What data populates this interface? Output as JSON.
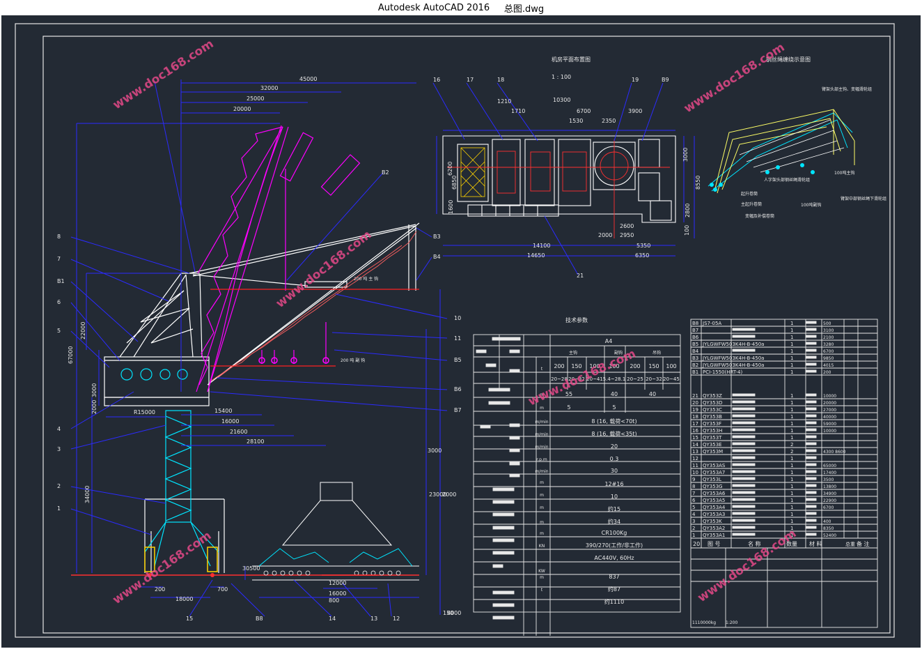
{
  "window": {
    "app": "Autodesk AutoCAD 2016",
    "file": "总图.dwg"
  },
  "colors": {
    "background": "#232a34",
    "frame": "#e6e6e6",
    "dimension": "#0000ff",
    "crane_boom": "#ff00ff",
    "crane_tower": "#00e5ff",
    "structure": "#ffffff",
    "load_marks": "#ff0000",
    "rigging": "#ffff66",
    "annotation": "#e8e8e8"
  },
  "watermark": "www.doc168.com",
  "plan_view": {
    "title": "机房平面布置图",
    "scale": "1 : 100",
    "labels": [
      "16",
      "17",
      "18",
      "19",
      "B9"
    ],
    "dims_top": [
      "10300",
      "1710",
      "6700",
      "1530",
      "2350",
      "3900",
      "1210"
    ],
    "dims_bottom": [
      "14100",
      "14650",
      "2000",
      "2950",
      "2600",
      "5350",
      "6350"
    ],
    "dims_side": [
      "6200",
      "6850",
      "1600",
      "3000",
      "8550",
      "2800",
      "100"
    ],
    "leader": "21"
  },
  "rigging_view": {
    "title": "钢丝绳缠绕示意图",
    "notes": [
      "臂架头部主钩、变幅滑轮组",
      "100吨主钩",
      "人字架头部钢丝绳滑轮组",
      "起升卷筒",
      "主起升卷筒",
      "100吨副钩",
      "臂架中部钢丝绳下滑轮组",
      "变幅及补偿卷筒"
    ]
  },
  "elevation": {
    "top_dims": [
      "45000",
      "32000",
      "25000",
      "20000"
    ],
    "side_dims": [
      "67000",
      "22000",
      "3000",
      "2000",
      "34000"
    ],
    "bottom_dims": [
      "R15000",
      "15400",
      "16000",
      "21600",
      "28100",
      "200",
      "18000",
      "700",
      "12000",
      "16000",
      "800",
      "30500",
      "150",
      "2000",
      "3000",
      "4000",
      "23000"
    ],
    "callouts_left": [
      "8",
      "7",
      "B1",
      "6",
      "5",
      "4",
      "3",
      "2",
      "1"
    ],
    "callouts_right": [
      "B2",
      "B3",
      "B4",
      "10",
      "11",
      "B5",
      "B6",
      "B7"
    ],
    "callouts_bottom": [
      "15",
      "B8",
      "14",
      "13",
      "12"
    ],
    "side_notes": [
      "200 吨 主 钩",
      "200 吨 副 钩"
    ]
  },
  "tech_table": {
    "title": "技术参数",
    "header": "A4",
    "subheads": [
      "主钩",
      "副钩",
      "吊钩"
    ],
    "loads": [
      "200",
      "150",
      "100",
      "100",
      "200",
      "150",
      "100"
    ],
    "ranges": [
      "20~28",
      "20~32",
      "20~41",
      "5.4~28.1",
      "20~25",
      "20~32",
      "20~45"
    ],
    "row_units": [
      "t",
      "m",
      "m",
      "m/min",
      "m/min",
      "m/min",
      "r.p.m",
      "m/min",
      "m",
      "m",
      "m",
      "m",
      "m",
      "KN",
      "",
      "KW",
      "m",
      "t"
    ],
    "rows": [
      "55",
      "40",
      "40",
      "5",
      "5",
      "8 (16, 载荷<70t)",
      "8 (16, 载荷<35t)",
      "20",
      "0.3",
      "30",
      "12#16",
      "10",
      "约15",
      "约34",
      "CR100Kg",
      "390/270(工作/非工作)",
      "AC440V, 60Hz",
      "837",
      "约87",
      "约1110"
    ]
  },
  "parts_list": {
    "rows": [
      {
        "no": "B8",
        "code": "JS7-05A",
        "qty": "1",
        "mass": "500"
      },
      {
        "no": "B7",
        "code": "",
        "qty": "1",
        "mass": "3100"
      },
      {
        "no": "B6",
        "code": "",
        "qty": "1",
        "mass": "2100"
      },
      {
        "no": "B5",
        "code": "JYLGWFW503K4H-B-450a",
        "qty": "1",
        "mass": "3280"
      },
      {
        "no": "B4",
        "code": "",
        "qty": "1",
        "mass": "6700"
      },
      {
        "no": "B3",
        "code": "JYLGWFW503K4H-B-450a",
        "qty": "1",
        "mass": "9850"
      },
      {
        "no": "B2",
        "code": "JYLGWFW503K4H-B-450a",
        "qty": "1",
        "mass": "4015"
      },
      {
        "no": "B1",
        "code": "PCI-1550(HRT-4)",
        "qty": "1",
        "mass": "200"
      },
      {
        "no": "21",
        "code": "QY353Z",
        "qty": "1",
        "mass": "10000"
      },
      {
        "no": "20",
        "code": "QY353D",
        "qty": "1",
        "mass": "20000"
      },
      {
        "no": "19",
        "code": "QY353C",
        "qty": "1",
        "mass": "27000"
      },
      {
        "no": "18",
        "code": "QY353B",
        "qty": "1",
        "mass": "40000"
      },
      {
        "no": "17",
        "code": "QY353F",
        "qty": "1",
        "mass": "59000"
      },
      {
        "no": "16",
        "code": "QY353H",
        "qty": "1",
        "mass": "10000"
      },
      {
        "no": "15",
        "code": "QY353T",
        "qty": "1",
        "mass": ""
      },
      {
        "no": "14",
        "code": "QY353E",
        "qty": "2",
        "mass": ""
      },
      {
        "no": "13",
        "code": "QY353M",
        "qty": "2",
        "mass": "4300  8600"
      },
      {
        "no": "12",
        "code": "",
        "qty": "1",
        "mass": ""
      },
      {
        "no": "11",
        "code": "QY353AS",
        "qty": "1",
        "mass": "65000"
      },
      {
        "no": "10",
        "code": "QY353A7",
        "qty": "1",
        "mass": "17400"
      },
      {
        "no": "9",
        "code": "QY353L",
        "qty": "1",
        "mass": "3500"
      },
      {
        "no": "8",
        "code": "QY353G",
        "qty": "1",
        "mass": "13800"
      },
      {
        "no": "7",
        "code": "QY353A6",
        "qty": "1",
        "mass": "34900"
      },
      {
        "no": "6",
        "code": "QY353A5",
        "qty": "1",
        "mass": "22900"
      },
      {
        "no": "5",
        "code": "QY353A4",
        "qty": "1",
        "mass": "6700"
      },
      {
        "no": "4",
        "code": "QY353A3",
        "qty": "1",
        "mass": ""
      },
      {
        "no": "3",
        "code": "QY353K",
        "qty": "1",
        "mass": "400"
      },
      {
        "no": "2",
        "code": "QY353A2",
        "qty": "1",
        "mass": "8350"
      },
      {
        "no": "1",
        "code": "QY353A1",
        "qty": "1",
        "mass": "52400"
      }
    ],
    "header": [
      "20",
      "图 号",
      "名 称",
      "数量",
      "材 料",
      "备 注"
    ],
    "header_mass": "总重",
    "footer_mass": "1110000kg",
    "footer_scale": "1:200"
  }
}
